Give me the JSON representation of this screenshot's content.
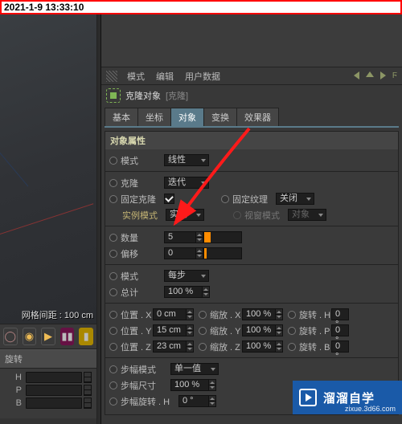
{
  "timestamp": "2021-1-9 13:33:10",
  "viewport": {
    "grid_label": "网格间距 : 100 cm"
  },
  "timeline_icons": [
    "circle",
    "record",
    "play",
    "film",
    "clip"
  ],
  "left_rotate": {
    "title": "旋转",
    "rows": [
      "H",
      "P",
      "B"
    ]
  },
  "menu": {
    "items": [
      "模式",
      "编辑",
      "用户数据"
    ],
    "fn": "Ϝ"
  },
  "object": {
    "icon": "cloner-icon",
    "name": "克隆对象",
    "sub": "[克隆]"
  },
  "tabs": [
    {
      "label": "基本",
      "active": false
    },
    {
      "label": "坐标",
      "active": false
    },
    {
      "label": "对象",
      "active": true
    },
    {
      "label": "变换",
      "active": false
    },
    {
      "label": "效果器",
      "active": false
    }
  ],
  "section_title": "对象属性",
  "props": {
    "mode": {
      "label": "模式",
      "value": "线性"
    },
    "clone": {
      "label": "克隆",
      "value": "迭代"
    },
    "fixed_clone": {
      "label": "固定克隆",
      "checked": true
    },
    "fixed_tex": {
      "label": "固定纹理",
      "value": "关闭"
    },
    "inst_mode": {
      "label": "实例模式",
      "value": "实例"
    },
    "view_mode": {
      "label": "视窗模式",
      "value": "对象"
    },
    "count": {
      "label": "数量",
      "value": "5"
    },
    "offset": {
      "label": "偏移",
      "value": "0"
    },
    "per_mode": {
      "label": "模式",
      "value": "每步"
    },
    "total": {
      "label": "总计",
      "value": "100 %"
    },
    "pos": {
      "x": {
        "label": "位置 . X",
        "value": "0 cm"
      },
      "y": {
        "label": "位置 . Y",
        "value": "15 cm"
      },
      "z": {
        "label": "位置 . Z",
        "value": "23 cm"
      }
    },
    "scale": {
      "x": {
        "label": "缩放 . X",
        "value": "100 %"
      },
      "y": {
        "label": "缩放 . Y",
        "value": "100 %"
      },
      "z": {
        "label": "缩放 . Z",
        "value": "100 %"
      }
    },
    "rot": {
      "h": {
        "label": "旋转 . H",
        "value": "0 °"
      },
      "p": {
        "label": "旋转 . P",
        "value": "0 °"
      },
      "b": {
        "label": "旋转 . B",
        "value": "0 °"
      }
    },
    "step_mode": {
      "label": "步幅模式",
      "value": "单一值"
    },
    "step_size": {
      "label": "步幅尺寸",
      "value": "100 %"
    },
    "step_rot": {
      "label": "步幅旋转 . H",
      "value": "0 °"
    }
  },
  "watermark": {
    "text": "溜溜自学",
    "url": "zixue.3d66.com"
  }
}
